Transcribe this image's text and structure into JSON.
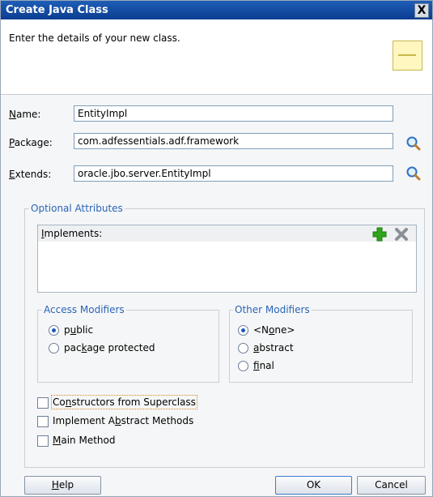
{
  "window": {
    "title": "Create Java Class",
    "close_glyph": "X"
  },
  "header": {
    "instructions": "Enter the details of your new class.",
    "icon": "note-icon"
  },
  "fields": {
    "name": {
      "label": "Name:",
      "value": "EntityImpl"
    },
    "package": {
      "label": "Package:",
      "value": "com.adfessentials.adf.framework"
    },
    "extends": {
      "label": "Extends:",
      "value": "oracle.jbo.server.EntityImpl"
    }
  },
  "optional": {
    "legend": "Optional Attributes",
    "implements_label": "Implements:",
    "access": {
      "legend": "Access Modifiers",
      "options": [
        {
          "label": "public",
          "selected": true
        },
        {
          "label": "package protected",
          "selected": false
        }
      ]
    },
    "other": {
      "legend": "Other Modifiers",
      "options": [
        {
          "label": "<None>",
          "selected": true
        },
        {
          "label": "abstract",
          "selected": false
        },
        {
          "label": "final",
          "selected": false
        }
      ]
    },
    "checkboxes": [
      {
        "label": "Constructors from Superclass",
        "checked": false
      },
      {
        "label": "Implement Abstract Methods",
        "checked": false
      },
      {
        "label": "Main Method",
        "checked": false
      }
    ]
  },
  "buttons": {
    "help": "Help",
    "ok": "OK",
    "cancel": "Cancel"
  },
  "colors": {
    "title_bar": "#0b3d91",
    "legend_text": "#2a64b6",
    "add_green": "#2fa51c",
    "remove_gray": "#8a8f96"
  }
}
